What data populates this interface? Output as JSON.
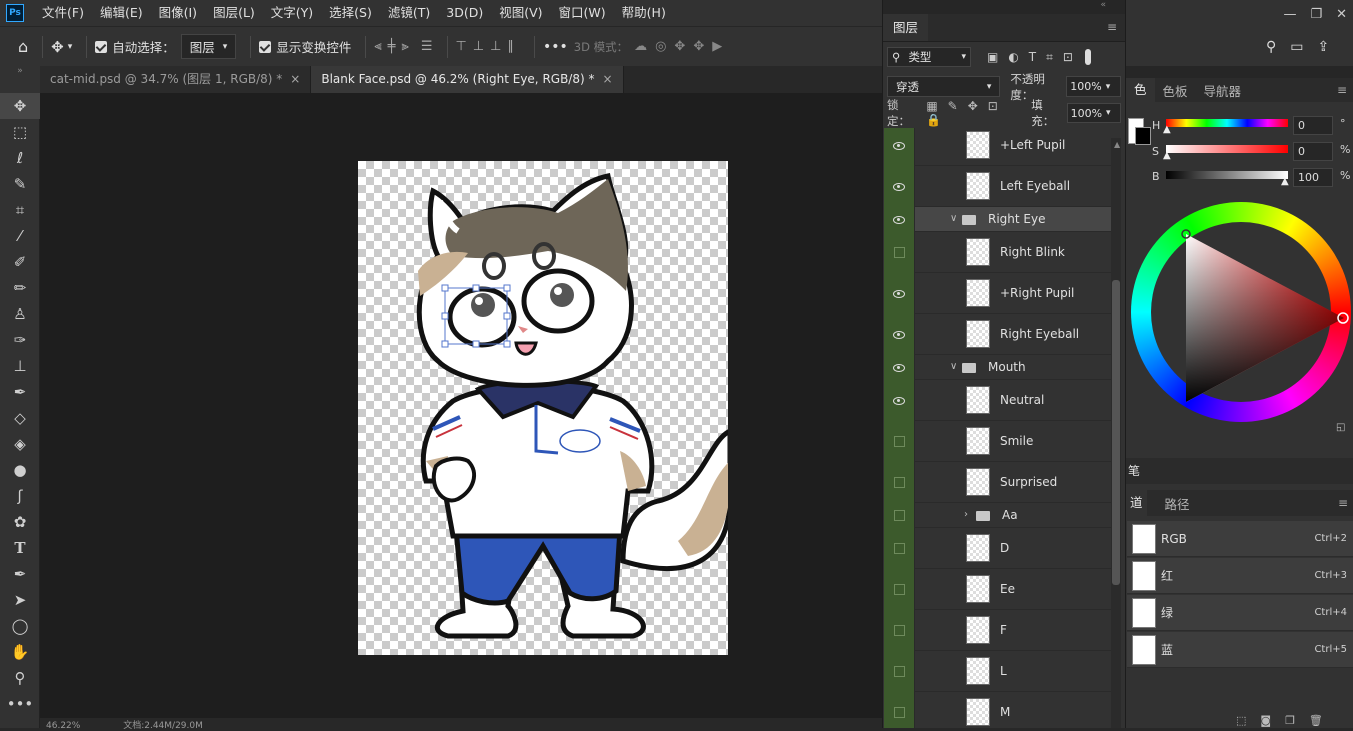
{
  "menu": {
    "logo": "Ps",
    "items": [
      "文件(F)",
      "编辑(E)",
      "图像(I)",
      "图层(L)",
      "文字(Y)",
      "选择(S)",
      "滤镜(T)",
      "3D(D)",
      "视图(V)",
      "窗口(W)",
      "帮助(H)"
    ]
  },
  "options": {
    "auto_select_label": "自动选择：",
    "auto_select_value": "图层",
    "show_transform_label": "显示变换控件",
    "mode_3d_label": "3D 模式："
  },
  "tabs": [
    {
      "label": "cat-mid.psd @ 34.7% (图层 1, RGB/8) *",
      "close": "×"
    },
    {
      "label": "Blank Face.psd @ 46.2% (Right Eye, RGB/8) *",
      "close": "×"
    }
  ],
  "layers_panel": {
    "title": "图层",
    "filter_label": "类型",
    "blend_mode": "穿透",
    "opacity_label": "不透明度：",
    "opacity_value": "100%",
    "lock_label": "锁定：",
    "fill_label": "填充：",
    "fill_value": "100%",
    "layers": [
      {
        "name": "+Left Pupil",
        "visible": true,
        "type": "layer"
      },
      {
        "name": "Left Eyeball",
        "visible": true,
        "type": "layer"
      },
      {
        "name": "Right Eye",
        "visible": true,
        "type": "group",
        "expanded": true
      },
      {
        "name": "Right Blink",
        "visible": false,
        "type": "layer"
      },
      {
        "name": "+Right Pupil",
        "visible": true,
        "type": "layer"
      },
      {
        "name": "Right Eyeball",
        "visible": true,
        "type": "layer"
      },
      {
        "name": "Mouth",
        "visible": true,
        "type": "group",
        "expanded": true
      },
      {
        "name": "Neutral",
        "visible": true,
        "type": "layer"
      },
      {
        "name": "Smile",
        "visible": false,
        "type": "layer"
      },
      {
        "name": "Surprised",
        "visible": false,
        "type": "layer"
      },
      {
        "name": "Aa",
        "visible": false,
        "type": "group",
        "expanded": false
      },
      {
        "name": "D",
        "visible": false,
        "type": "layer"
      },
      {
        "name": "Ee",
        "visible": false,
        "type": "layer"
      },
      {
        "name": "F",
        "visible": false,
        "type": "layer"
      },
      {
        "name": "L",
        "visible": false,
        "type": "layer"
      },
      {
        "name": "M",
        "visible": false,
        "type": "layer"
      }
    ]
  },
  "color_panel": {
    "tabs": [
      "色",
      "色板",
      "导航器"
    ],
    "h_label": "H",
    "h_value": "0",
    "h_unit": "°",
    "s_label": "S",
    "s_value": "0",
    "s_unit": "%",
    "b_label": "B",
    "b_value": "100",
    "b_unit": "%"
  },
  "brush_tab": "笔",
  "channels_panel": {
    "tabs": [
      "道",
      "路径"
    ],
    "channels": [
      {
        "name": "RGB",
        "shortcut": "Ctrl+2"
      },
      {
        "name": "红",
        "shortcut": "Ctrl+3"
      },
      {
        "name": "绿",
        "shortcut": "Ctrl+4"
      },
      {
        "name": "蓝",
        "shortcut": "Ctrl+5"
      }
    ]
  },
  "status": {
    "zoom": "46.22%",
    "doc": "文档:2.44M/29.0M"
  },
  "colors": {
    "accent": "#31a8ff",
    "visible_col": "#3c5a2c",
    "selection_row": "#474747"
  }
}
